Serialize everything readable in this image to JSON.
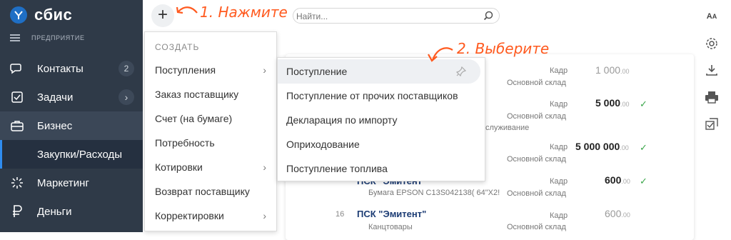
{
  "app": {
    "logo": "сбис",
    "org_label": "ПРЕДПРИЯТИЕ"
  },
  "sidebar": {
    "items": [
      {
        "label": "Контакты",
        "badge": "2",
        "icon": "contacts-icon"
      },
      {
        "label": "Задачи",
        "icon": "tasks-icon"
      },
      {
        "label": "Бизнес",
        "icon": "business-icon"
      },
      {
        "label": "Закупки/Расходы"
      },
      {
        "label": "Маркетинг",
        "icon": "marketing-icon"
      },
      {
        "label": "Деньги",
        "icon": "money-icon"
      }
    ]
  },
  "toolbar": {
    "plus_label": "+",
    "search_placeholder": "Найти..."
  },
  "annotations": {
    "step1": "1. Нажмите",
    "step2": "2. Выберите"
  },
  "menu": {
    "header": "СОЗДАТЬ",
    "items": [
      {
        "label": "Поступления",
        "arrow": "›"
      },
      {
        "label": "Заказ поставщику"
      },
      {
        "label": "Счет (на бумаге)"
      },
      {
        "label": "Потребность"
      },
      {
        "label": "Котировки",
        "arrow": "›"
      },
      {
        "label": "Возврат поставщику"
      },
      {
        "label": "Корректировки",
        "arrow": "›"
      }
    ]
  },
  "submenu": {
    "items": [
      {
        "label": "Поступление"
      },
      {
        "label": "Поступление от прочих поставщиков"
      },
      {
        "label": "Декларация по импорту"
      },
      {
        "label": "Оприходование"
      },
      {
        "label": "Поступление топлива"
      }
    ]
  },
  "rows": [
    {
      "role": "Кадр",
      "warehouse": "Основной склад",
      "amount": "1 000",
      "cents": ".00",
      "checked": false
    },
    {
      "role": "Кадр",
      "warehouse": "Основной склад",
      "amount": "5 000",
      "cents": ".00",
      "checked": true,
      "note": "служивание"
    },
    {
      "role": "Кадр",
      "warehouse": "Основной склад",
      "amount": "5 000 000",
      "cents": ".00",
      "checked": true
    },
    {
      "role": "Кадр",
      "warehouse": "Основной склад",
      "amount": "600",
      "cents": ".00",
      "checked": true,
      "org": "ПСК \"Эмитент\"",
      "desc": "Бумага EPSON C13S042138( 64\"X2!"
    },
    {
      "role": "Кадр",
      "warehouse": "Основной склад",
      "amount": "600",
      "cents": ".00",
      "checked": false,
      "num": "16",
      "org": "ПСК \"Эмитент\"",
      "desc": "Канцтовары"
    }
  ],
  "check_glyph": "✓",
  "colors": {
    "accent": "#ff5a1f",
    "sidebar": "#2f3a48",
    "link": "#1c3c74",
    "check": "#3aa64a"
  }
}
